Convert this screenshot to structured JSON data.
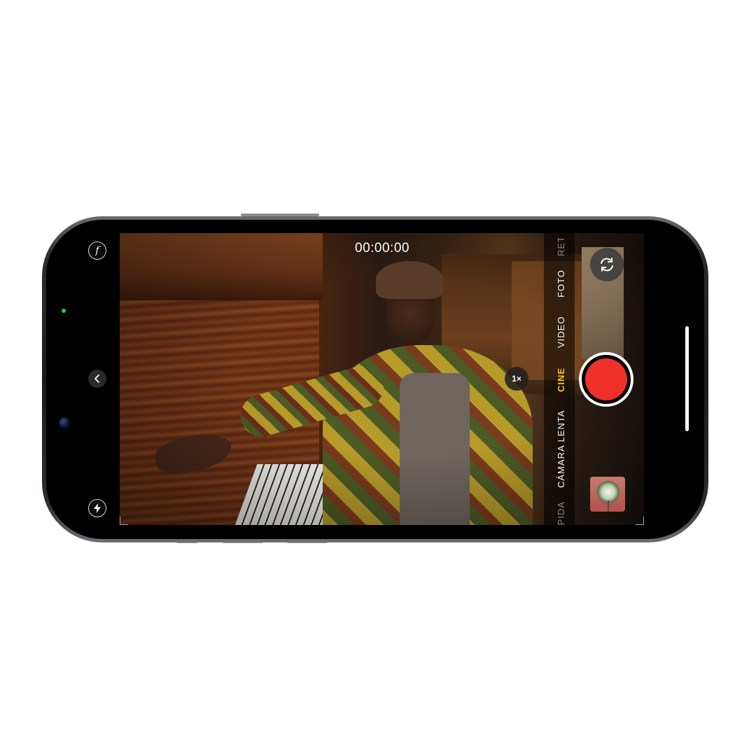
{
  "camera": {
    "timer": "00:00:00",
    "zoom_label": "1×",
    "modes": [
      {
        "label": "RETRATO",
        "state": "partial"
      },
      {
        "label": "FOTO",
        "state": "normal"
      },
      {
        "label": "VIDEO",
        "state": "normal"
      },
      {
        "label": "CINE",
        "state": "active"
      },
      {
        "label": "CÁMARA LENTA",
        "state": "normal"
      },
      {
        "label": "RÁPIDA",
        "state": "partial"
      }
    ],
    "left_controls": {
      "aperture_glyph": "f",
      "back_glyph": "‹",
      "flash_glyph": "⚡"
    },
    "icons": [
      "aperture-icon",
      "chevron-left-icon",
      "flash-icon",
      "flip-camera-icon",
      "shutter-record-button",
      "gallery-thumbnail"
    ],
    "colors": {
      "shutter_red": "#f0302a",
      "active_mode": "#f5c517",
      "status_dot": "#2ecc40"
    }
  }
}
